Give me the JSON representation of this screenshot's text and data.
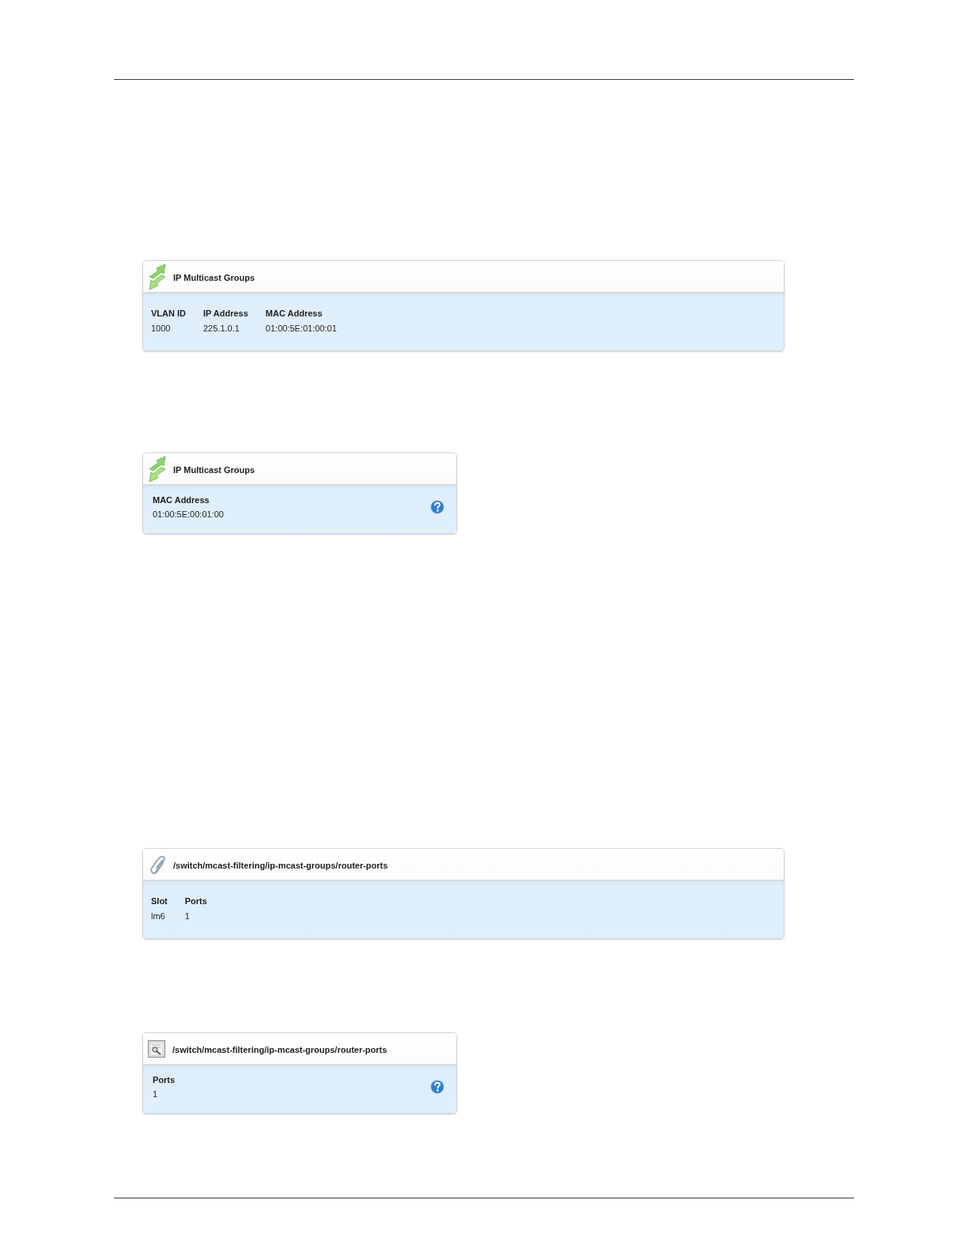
{
  "panels": [
    {
      "kind": "table",
      "title": "IP Multicast Groups",
      "columns": [
        "VLAN ID",
        "IP Address",
        "MAC Address"
      ],
      "rows": [
        [
          "1000",
          "225.1.0.1",
          "01:00:5E:01:00:01"
        ]
      ]
    },
    {
      "kind": "detail",
      "title": "IP Multicast Groups",
      "fields": [
        {
          "label": "MAC Address",
          "value": "01:00:5E:00:01:00"
        }
      ]
    },
    {
      "kind": "table",
      "title": "/switch/mcast-filtering/ip-mcast-groups/router-ports",
      "columns": [
        "Slot",
        "Ports"
      ],
      "rows": [
        [
          "lm6",
          "1"
        ]
      ]
    },
    {
      "kind": "detail",
      "title": "/switch/mcast-filtering/ip-mcast-groups/router-ports",
      "fields": [
        {
          "label": "Ports",
          "value": "1"
        }
      ]
    }
  ]
}
